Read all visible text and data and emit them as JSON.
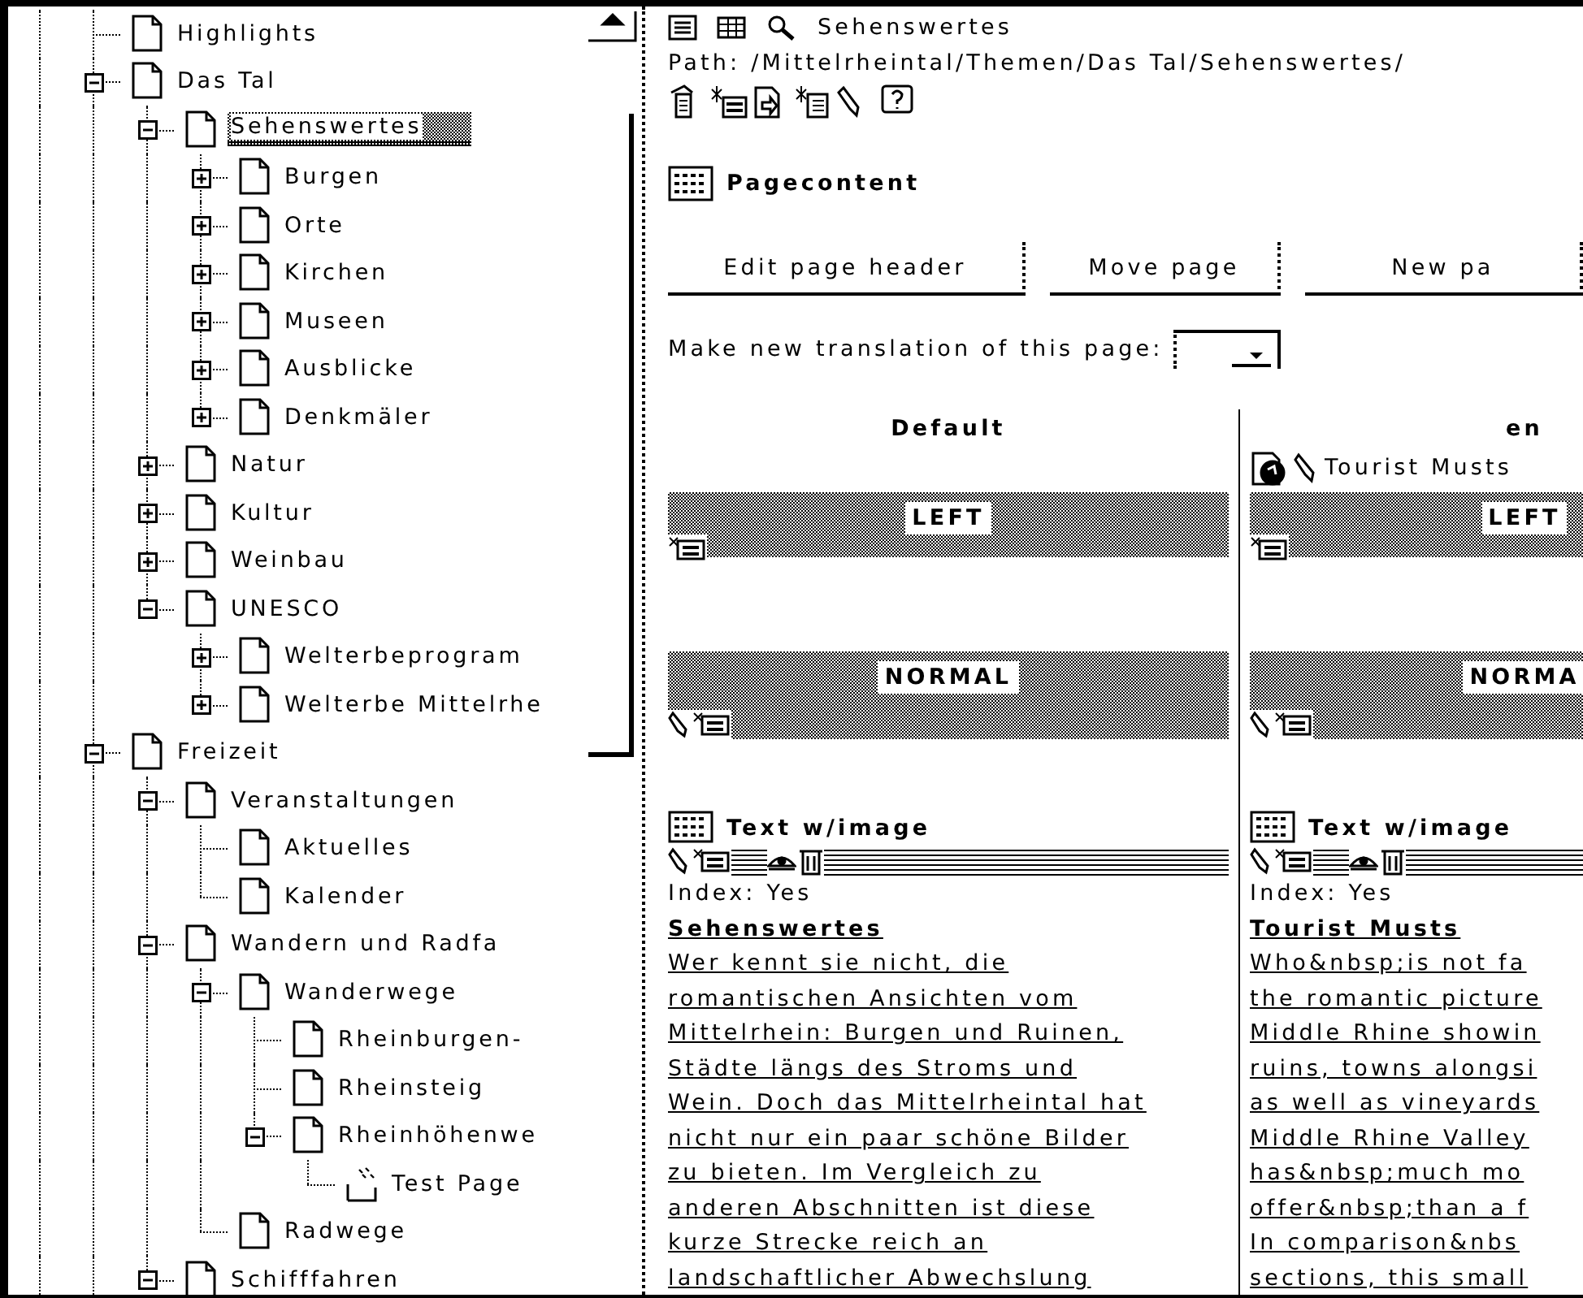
{
  "tree": {
    "items": [
      {
        "label": "Highlights",
        "kind": "page",
        "selected": false
      },
      {
        "label": "Das Tal",
        "kind": "page",
        "selected": false,
        "expanded": true,
        "children": [
          {
            "label": "Sehenswertes",
            "kind": "page",
            "selected": true,
            "expanded": true,
            "children": [
              {
                "label": "Burgen",
                "kind": "page",
                "selected": false,
                "expanded": false
              },
              {
                "label": "Orte",
                "kind": "page",
                "selected": false,
                "expanded": false
              },
              {
                "label": "Kirchen",
                "kind": "page",
                "selected": false,
                "expanded": false
              },
              {
                "label": "Museen",
                "kind": "page",
                "selected": false,
                "expanded": false
              },
              {
                "label": "Ausblicke",
                "kind": "page",
                "selected": false,
                "expanded": false
              },
              {
                "label": "Denkmäler",
                "kind": "page",
                "selected": false,
                "expanded": false
              }
            ]
          },
          {
            "label": "Natur",
            "kind": "page",
            "selected": false,
            "expanded": false
          },
          {
            "label": "Kultur",
            "kind": "page",
            "selected": false,
            "expanded": false
          },
          {
            "label": "Weinbau",
            "kind": "page",
            "selected": false,
            "expanded": false
          },
          {
            "label": "UNESCO",
            "kind": "page",
            "selected": false,
            "expanded": true,
            "children": [
              {
                "label": "Welterbeprogram",
                "kind": "page",
                "selected": false,
                "expanded": false
              },
              {
                "label": "Welterbe Mittelrhe",
                "kind": "page",
                "selected": false,
                "expanded": false
              }
            ]
          }
        ]
      },
      {
        "label": "Freizeit",
        "kind": "page",
        "selected": false,
        "expanded": true,
        "children": [
          {
            "label": "Veranstaltungen",
            "kind": "page",
            "selected": false,
            "expanded": true,
            "children": [
              {
                "label": "Aktuelles",
                "kind": "page",
                "selected": false
              },
              {
                "label": "Kalender",
                "kind": "page",
                "selected": false
              }
            ]
          },
          {
            "label": "Wandern und Radfa",
            "kind": "page",
            "selected": false,
            "expanded": true,
            "children": [
              {
                "label": "Wanderwege",
                "kind": "page",
                "selected": false,
                "expanded": true,
                "children": [
                  {
                    "label": "Rheinburgen-",
                    "kind": "page",
                    "selected": false
                  },
                  {
                    "label": "Rheinsteig",
                    "kind": "page",
                    "selected": false
                  },
                  {
                    "label": "Rheinhöhenwe",
                    "kind": "page",
                    "selected": false,
                    "expanded": true,
                    "children": [
                      {
                        "label": "Test Page",
                        "kind": "hidden",
                        "selected": false
                      }
                    ]
                  }
                ]
              },
              {
                "label": "Radwege",
                "kind": "page",
                "selected": false
              }
            ]
          },
          {
            "label": "Schifffahren",
            "kind": "page",
            "selected": false,
            "expanded": true
          }
        ]
      }
    ]
  },
  "page_header": {
    "title": "Sehenswertes",
    "path": "Path: /Mittelrheintal/Themen/Das Tal/Sehenswertes/"
  },
  "section_title": "Pagecontent",
  "buttons": [
    "Edit page header",
    "Move page",
    "New pa"
  ],
  "translation": {
    "label": "Make new translation of this page:"
  },
  "columns": [
    {
      "heading": "Default",
      "areas": [
        "LEFT",
        "NORMAL"
      ],
      "element": {
        "type": "Text w/image",
        "index": "Index: Yes",
        "header": "Sehenswertes",
        "lines": [
          "Wer kennt sie nicht, die",
          "romantischen Ansichten vom",
          "Mittelrhein: Burgen und Ruinen,",
          "Städte längs des Stroms und",
          "Wein. Doch das Mittelrheintal hat",
          "nicht nur ein paar schöne Bilder",
          "zu bieten. Im Vergleich zu",
          "anderen Abschnitten ist diese",
          "kurze Strecke reich an",
          "landschaftlicher Abwechslung"
        ]
      }
    },
    {
      "heading": "en",
      "record_title": "Tourist Musts",
      "areas": [
        "LEFT",
        "NORMA"
      ],
      "element": {
        "type": "Text w/image",
        "index": "Index: Yes",
        "header": "Tourist Musts",
        "lines": [
          "Who&nbsp;is not fa",
          "the romantic picture",
          "Middle Rhine showin",
          "ruins, towns alongsi",
          "as well as vineyards",
          "Middle Rhine Valley",
          "has&nbsp;much mo",
          "offer&nbsp;than a f",
          "In comparison&nbs",
          "sections, this small"
        ]
      }
    }
  ]
}
